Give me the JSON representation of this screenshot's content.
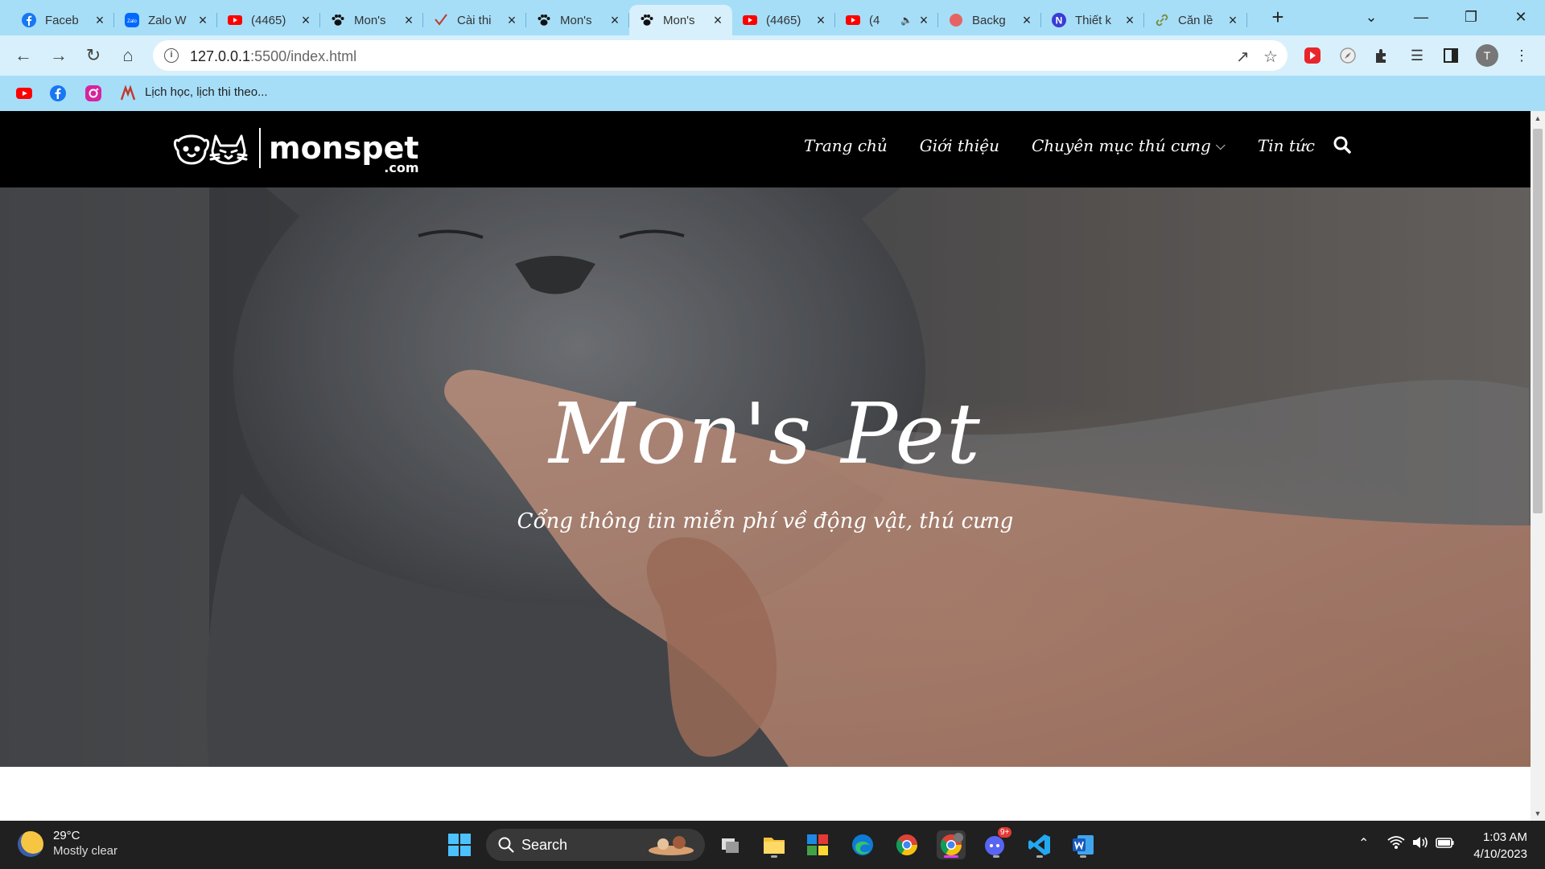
{
  "browser": {
    "tabs": [
      {
        "title": "Faceb",
        "icon": "facebook-icon",
        "active": false,
        "muted": false
      },
      {
        "title": "Zalo W",
        "icon": "zalo-icon",
        "active": false,
        "muted": false
      },
      {
        "title": "(4465)",
        "icon": "youtube-icon",
        "active": false,
        "muted": false
      },
      {
        "title": "Mon's",
        "icon": "paw-icon",
        "active": false,
        "muted": false
      },
      {
        "title": "Cài thi",
        "icon": "checkmark-icon",
        "active": false,
        "muted": false
      },
      {
        "title": "Mon's",
        "icon": "paw-icon",
        "active": false,
        "muted": false
      },
      {
        "title": "Mon's",
        "icon": "paw-icon",
        "active": true,
        "muted": false
      },
      {
        "title": "(4465)",
        "icon": "youtube-icon",
        "active": false,
        "muted": false
      },
      {
        "title": "(4",
        "icon": "youtube-icon",
        "active": false,
        "muted": true
      },
      {
        "title": "Backg",
        "icon": "red-circle-icon",
        "active": false,
        "muted": false
      },
      {
        "title": "Thiết k",
        "icon": "notion-icon",
        "active": false,
        "muted": false
      },
      {
        "title": "Căn lề",
        "icon": "link-icon",
        "active": false,
        "muted": false
      }
    ],
    "url_host": "127.0.0.1",
    "url_rest": ":5500/index.html",
    "bookmark_label": "Lịch học, lịch thi theo...",
    "profile_initial": "T"
  },
  "site": {
    "logo_text": "monspet",
    "logo_sub": ".com",
    "menu": [
      "Trang chủ",
      "Giới thiệu",
      "Chuyên mục thú cưng",
      "Tin tức"
    ],
    "hero_title": "Mon's Pet",
    "hero_subtitle": "Cổng thông tin miễn phí về động vật, thú cưng"
  },
  "taskbar": {
    "temperature": "29°C",
    "weather": "Mostly clear",
    "search_label": "Search",
    "time": "1:03 AM",
    "date": "4/10/2023",
    "discord_badge": "9+"
  },
  "colors": {
    "tab_strip": "#a6def8",
    "toolbar": "#d7f0fc",
    "site_header": "#000000",
    "taskbar": "#202020"
  }
}
